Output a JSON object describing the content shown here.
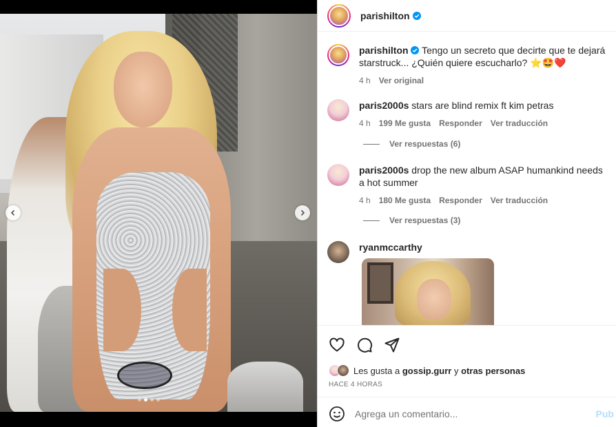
{
  "post": {
    "author": "parishilton",
    "verified": true
  },
  "caption": {
    "author": "parishilton",
    "text": "Tengo un secreto que decirte que te dejará starstruck... ¿Quién quiere escucharlo? ⭐🤩❤️",
    "time": "4 h",
    "see_original": "Ver original"
  },
  "comments": [
    {
      "author": "paris2000s",
      "text": "stars are blind remix ft kim petras",
      "time": "4 h",
      "likes": "199 Me gusta",
      "reply": "Responder",
      "translate": "Ver traducción",
      "replies_label": "Ver respuestas (6)"
    },
    {
      "author": "paris2000s",
      "text": "drop the new album ASAP humankind needs a hot summer",
      "time": "4 h",
      "likes": "180 Me gusta",
      "reply": "Responder",
      "translate": "Ver traducción",
      "replies_label": "Ver respuestas (3)"
    },
    {
      "author": "ryanmccarthy",
      "text": ""
    }
  ],
  "likes_line": {
    "prefix": "Les gusta a",
    "user": "gossip.gurr",
    "joiner": "y",
    "others": "otras personas"
  },
  "time_ago": "HACE 4 HORAS",
  "composer": {
    "placeholder": "Agrega un comentario...",
    "post_label": "Pub"
  },
  "carousel": {
    "slides": 4,
    "active": 1
  },
  "colors": {
    "verified_blue": "#0095f6",
    "post_disabled": "#b2dffc",
    "secondary_text": "#737373"
  },
  "icons": [
    "chevron-left-icon",
    "chevron-right-icon",
    "heart-icon",
    "comment-icon",
    "share-icon",
    "verified-icon",
    "emoji-icon"
  ]
}
